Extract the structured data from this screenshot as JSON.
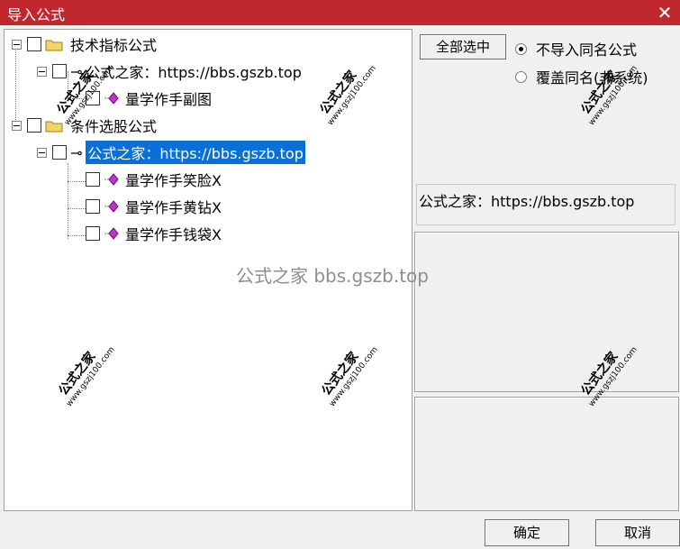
{
  "window": {
    "title": "导入公式",
    "close_glyph": "✕"
  },
  "tree": {
    "groups": [
      {
        "label": "技术指标公式",
        "child": "公式之家：https://bbs.gszb.top",
        "items": [
          "量学作手副图"
        ]
      },
      {
        "label": "条件选股公式",
        "child": "公式之家：https://bbs.gszb.top",
        "items": [
          "量学作手笑脸X",
          "量学作手黄钻X",
          "量学作手钱袋X"
        ]
      }
    ]
  },
  "controls": {
    "select_all": "全部选中",
    "radio_options": [
      "不导入同名公式",
      "覆盖同名(非系统)"
    ],
    "selected_radio": 0,
    "info_text": "公式之家：https://bbs.gszb.top",
    "ok": "确定",
    "cancel": "取消"
  },
  "watermark": {
    "center_text": "公式之家 bbs.gszb.top",
    "stamp_title": "公式之家",
    "stamp_url": "www.gszj100.com"
  },
  "colors": {
    "title_bar": "#c0282e",
    "selection": "#0a70d8"
  }
}
